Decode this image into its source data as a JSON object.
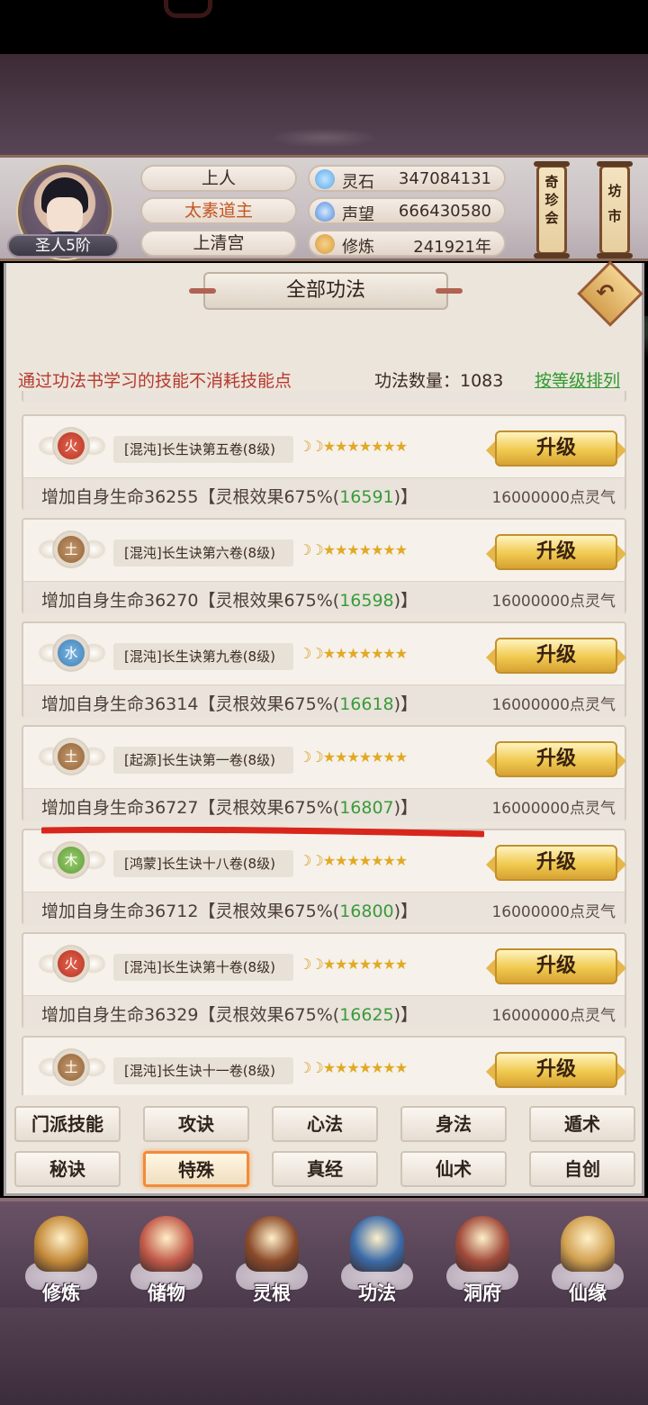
{
  "profile": {
    "rank": "圣人5阶",
    "title": "上人",
    "honor": "太素道主",
    "sect": "上清宫"
  },
  "resources": [
    {
      "label": "灵石",
      "value": "347084131",
      "icon": "crystal-icon",
      "color": "#5aa7e8"
    },
    {
      "label": "声望",
      "value": "666430580",
      "icon": "flame-icon",
      "color": "#4f8ad8"
    },
    {
      "label": "修炼",
      "value": "241921年",
      "icon": "meditation-icon",
      "color": "#d79a3b"
    }
  ],
  "shortcuts": [
    {
      "label": "奇珍会"
    },
    {
      "label": "坊市"
    }
  ],
  "panel": {
    "title": "全部功法",
    "note": "通过功法书学习的技能不消耗技能点",
    "count": "功法数量：1083",
    "sort": "按等级排列"
  },
  "skills": [
    {
      "element": "火",
      "el_class": "fire",
      "name": "[混沌]长生诀第五卷(8级)",
      "base": "增加自身生命36255【灵根效果675%(",
      "bonus": "16591",
      "tail": ")】",
      "cost": "16000000点灵气",
      "button": "升级"
    },
    {
      "element": "土",
      "el_class": "earth",
      "name": "[混沌]长生诀第六卷(8级)",
      "base": "增加自身生命36270【灵根效果675%(",
      "bonus": "16598",
      "tail": ")】",
      "cost": "16000000点灵气",
      "button": "升级"
    },
    {
      "element": "水",
      "el_class": "water",
      "name": "[混沌]长生诀第九卷(8级)",
      "base": "增加自身生命36314【灵根效果675%(",
      "bonus": "16618",
      "tail": ")】",
      "cost": "16000000点灵气",
      "button": "升级"
    },
    {
      "element": "土",
      "el_class": "earth",
      "name": "[起源]长生诀第一卷(8级)",
      "base": "增加自身生命36727【灵根效果675%(",
      "bonus": "16807",
      "tail": ")】",
      "cost": "16000000点灵气",
      "button": "升级"
    },
    {
      "element": "木",
      "el_class": "wood",
      "name": "[鸿蒙]长生诀十八卷(8级)",
      "base": "增加自身生命36712【灵根效果675%(",
      "bonus": "16800",
      "tail": ")】",
      "cost": "16000000点灵气",
      "button": "升级"
    },
    {
      "element": "火",
      "el_class": "fire",
      "name": "[混沌]长生诀第十卷(8级)",
      "base": "增加自身生命36329【灵根效果675%(",
      "bonus": "16625",
      "tail": ")】",
      "cost": "16000000点灵气",
      "button": "升级"
    },
    {
      "element": "土",
      "el_class": "earth",
      "name": "[混沌]长生诀十一卷(8级)",
      "base": "",
      "bonus": "",
      "tail": "",
      "cost": "",
      "button": "升级"
    }
  ],
  "star_rating": {
    "moons": 2,
    "stars": 7
  },
  "categories": [
    "门派技能",
    "攻诀",
    "心法",
    "身法",
    "遁术",
    "秘诀",
    "特殊",
    "真经",
    "仙术",
    "自创"
  ],
  "active_category": "特殊",
  "nav": [
    {
      "label": "修炼",
      "icon": "meditation-monk-icon",
      "color": "#c48a3a"
    },
    {
      "label": "储物",
      "icon": "storage-bag-icon",
      "color": "#c25a4a"
    },
    {
      "label": "灵根",
      "icon": "spirit-root-icon",
      "color": "#8a4a2a"
    },
    {
      "label": "功法",
      "icon": "skill-book-icon",
      "color": "#3a6aa8"
    },
    {
      "label": "洞府",
      "icon": "cave-mansion-icon",
      "color": "#a04a3a"
    },
    {
      "label": "仙缘",
      "icon": "gourd-icon",
      "color": "#d0a050"
    }
  ]
}
